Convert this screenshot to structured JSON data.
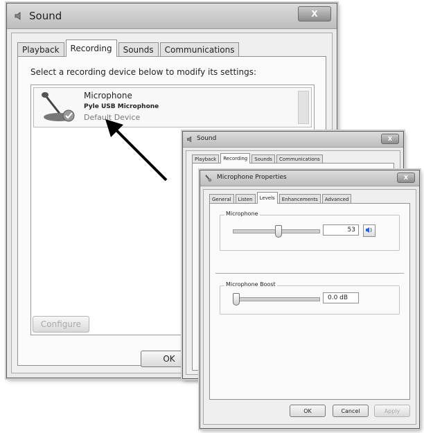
{
  "sound_main": {
    "title": "Sound",
    "tabs": [
      {
        "label": "Playback",
        "active": false
      },
      {
        "label": "Recording",
        "active": true
      },
      {
        "label": "Sounds",
        "active": false
      },
      {
        "label": "Communications",
        "active": false
      }
    ],
    "instruction": "Select a recording device below to modify its settings:",
    "device": {
      "name": "Microphone",
      "model": "Pyle USB Microphone",
      "status": "Default Device"
    },
    "configure_label": "Configure",
    "ok_label": "OK",
    "close_label": "X"
  },
  "sound_back": {
    "title": "Sound",
    "close_label": "X",
    "tabs": [
      {
        "label": "Playback",
        "active": false
      },
      {
        "label": "Recording",
        "active": true
      },
      {
        "label": "Sounds",
        "active": false
      },
      {
        "label": "Communications",
        "active": false
      }
    ]
  },
  "mic_props": {
    "title": "Microphone Properties",
    "close_label": "X",
    "tabs": [
      {
        "label": "General",
        "active": false
      },
      {
        "label": "Listen",
        "active": false
      },
      {
        "label": "Levels",
        "active": true
      },
      {
        "label": "Enhancements",
        "active": false
      },
      {
        "label": "Advanced",
        "active": false
      }
    ],
    "microphone": {
      "label": "Microphone",
      "value": "53",
      "level_percent": 53
    },
    "boost": {
      "label": "Microphone Boost",
      "value": "0.0 dB",
      "level_percent": 0
    },
    "buttons": {
      "ok": "OK",
      "cancel": "Cancel",
      "apply": "Apply"
    }
  },
  "colors": {
    "arrow": "#000000",
    "accent": "#2a64c8"
  }
}
